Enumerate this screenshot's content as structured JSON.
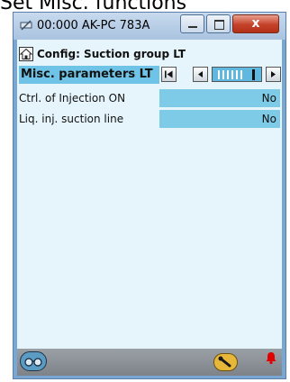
{
  "page_caption": "Set Misc. functions",
  "window": {
    "title": "00:000 AK-PC 783A",
    "close_label": "x"
  },
  "screen": {
    "title": "Config: Suction group LT"
  },
  "submenu": {
    "title": "Misc. parameters LT",
    "scroll_position": 0.9
  },
  "rows": [
    {
      "label": "Ctrl. of Injection ON",
      "value": "No"
    },
    {
      "label": "Liq. inj. suction line",
      "value": "No"
    }
  ],
  "colors": {
    "header_highlight": "#6fc3e6",
    "value_cell": "#7ecbe8",
    "client_bg": "#e6f5fc",
    "window_frame": "#7aa7d2",
    "close_button": "#c4412a",
    "alarm_bell": "#e00000",
    "service_button": "#e7b73a"
  },
  "icons": {
    "app": "app-icon",
    "home": "home-icon",
    "first": "skip-first-icon",
    "prev": "step-back-icon",
    "next": "step-forward-icon",
    "glasses": "glasses-icon",
    "wrench": "wrench-icon",
    "bell": "alarm-bell-icon"
  }
}
